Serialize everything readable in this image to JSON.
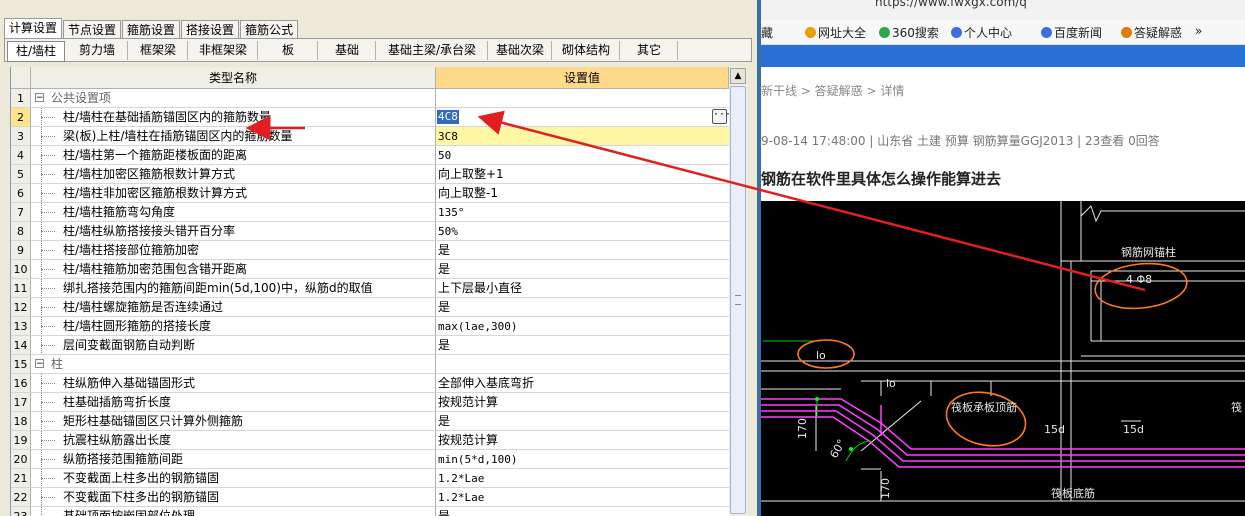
{
  "top_tabs": [
    "计算设置",
    "节点设置",
    "箍筋设置",
    "搭接设置",
    "箍筋公式"
  ],
  "sub_tabs": [
    "柱/墙柱",
    "剪力墙",
    "框架梁",
    "非框架梁",
    "板",
    "基础",
    "基础主梁/承台梁",
    "基础次梁",
    "砌体结构",
    "其它"
  ],
  "grid": {
    "header_name": "类型名称",
    "header_value": "设置值",
    "rows": [
      {
        "n": "1",
        "name": "公共设置项",
        "value": "",
        "group": true
      },
      {
        "n": "2",
        "name": "柱/墙柱在基础插筋锚固区内的箍筋数量",
        "value": "4C8",
        "current": true
      },
      {
        "n": "3",
        "name": "梁(板)上柱/墙柱在插筋锚固区内的箍筋数量",
        "value": "3C8",
        "highlight": true
      },
      {
        "n": "4",
        "name": "柱/墙柱第一个箍筋距楼板面的距离",
        "value": "50"
      },
      {
        "n": "5",
        "name": "柱/墙柱加密区箍筋根数计算方式",
        "value": "向上取整+1",
        "zh": true
      },
      {
        "n": "6",
        "name": "柱/墙柱非加密区箍筋根数计算方式",
        "value": "向上取整-1",
        "zh": true
      },
      {
        "n": "7",
        "name": "柱/墙柱箍筋弯勾角度",
        "value": "135°"
      },
      {
        "n": "8",
        "name": "柱/墙柱纵筋搭接接头错开百分率",
        "value": "50%"
      },
      {
        "n": "9",
        "name": "柱/墙柱搭接部位箍筋加密",
        "value": "是",
        "zh": true
      },
      {
        "n": "10",
        "name": "柱/墙柱箍筋加密范围包含错开距离",
        "value": "是",
        "zh": true
      },
      {
        "n": "11",
        "name": "绑扎搭接范围内的箍筋间距min(5d,100)中，纵筋d的取值",
        "value": "上下层最小直径",
        "zh": true
      },
      {
        "n": "12",
        "name": "柱/墙柱螺旋箍筋是否连续通过",
        "value": "是",
        "zh": true
      },
      {
        "n": "13",
        "name": "柱/墙柱圆形箍筋的搭接长度",
        "value": "max(lae,300)"
      },
      {
        "n": "14",
        "name": "层间变截面钢筋自动判断",
        "value": "是",
        "zh": true
      },
      {
        "n": "15",
        "name": "柱",
        "value": "",
        "group": true
      },
      {
        "n": "16",
        "name": "柱纵筋伸入基础锚固形式",
        "value": "全部伸入基底弯折",
        "zh": true
      },
      {
        "n": "17",
        "name": "柱基础插筋弯折长度",
        "value": "按规范计算",
        "zh": true
      },
      {
        "n": "18",
        "name": "矩形柱基础锚固区只计算外侧箍筋",
        "value": "是",
        "zh": true
      },
      {
        "n": "19",
        "name": "抗震柱纵筋露出长度",
        "value": "按规范计算",
        "zh": true
      },
      {
        "n": "20",
        "name": "纵筋搭接范围箍筋间距",
        "value": "min(5*d,100)"
      },
      {
        "n": "21",
        "name": "不变截面上柱多出的钢筋锚固",
        "value": "1.2*Lae"
      },
      {
        "n": "22",
        "name": "不变截面下柱多出的钢筋锚固",
        "value": "1.2*Lae"
      },
      {
        "n": "23",
        "name": "基础顶面按嵌固部位处理",
        "value": "是",
        "zh": true
      }
    ]
  },
  "browser": {
    "url": "https://www.fwxgx.com/q",
    "favorites": [
      "藏",
      "网址大全",
      "360搜索",
      "个人中心",
      "百度新闻",
      "答疑解惑",
      "»"
    ],
    "breadcrumb": "新干线 > 答疑解惑 > 详情",
    "meta": "9-08-14 17:48:00  |  山东省  土建 预算 钢筋算量GGJ2013  |  23查看  0回答",
    "article_title": "钢筋在软件里具体怎么操作能算进去",
    "cad_labels": [
      "钢筋网锚柱",
      "4 Φ8",
      "lo",
      "lo",
      "筏板承板顶筋",
      "15d",
      "15d",
      "170",
      "60°",
      "170",
      "筏板底筋",
      "筏"
    ]
  },
  "colors": {
    "annotation": "#e02020",
    "cad_magenta": "#ff40ff",
    "cad_white": "#e8e8e8",
    "circle": "#ff7a1a"
  }
}
